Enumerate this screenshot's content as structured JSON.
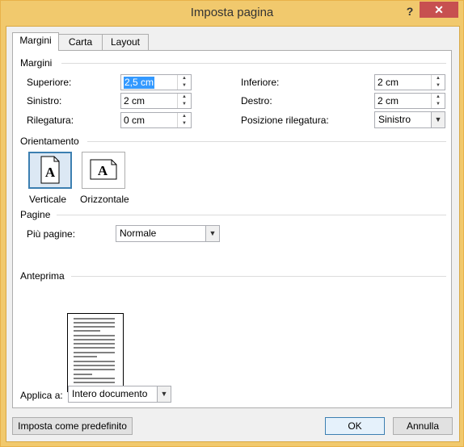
{
  "window": {
    "title": "Imposta pagina",
    "help": "?",
    "close": "✕"
  },
  "tabs": [
    {
      "label": "Margini"
    },
    {
      "label": "Carta"
    },
    {
      "label": "Layout"
    }
  ],
  "margins": {
    "section": "Margini",
    "top_label": "Superiore:",
    "top_value": "2,5 cm",
    "bottom_label": "Inferiore:",
    "bottom_value": "2 cm",
    "left_label": "Sinistro:",
    "left_value": "2 cm",
    "right_label": "Destro:",
    "right_value": "2 cm",
    "gutter_label": "Rilegatura:",
    "gutter_value": "0 cm",
    "gutter_pos_label": "Posizione rilegatura:",
    "gutter_pos_value": "Sinistro"
  },
  "orientation": {
    "section": "Orientamento",
    "portrait": "Verticale",
    "landscape": "Orizzontale",
    "icon_letter": "A"
  },
  "pages": {
    "section": "Pagine",
    "multiple_label": "Più pagine:",
    "multiple_value": "Normale"
  },
  "preview": {
    "section": "Anteprima"
  },
  "apply": {
    "label": "Applica a:",
    "value": "Intero documento"
  },
  "buttons": {
    "default": "Imposta come predefinito",
    "ok": "OK",
    "cancel": "Annulla"
  }
}
